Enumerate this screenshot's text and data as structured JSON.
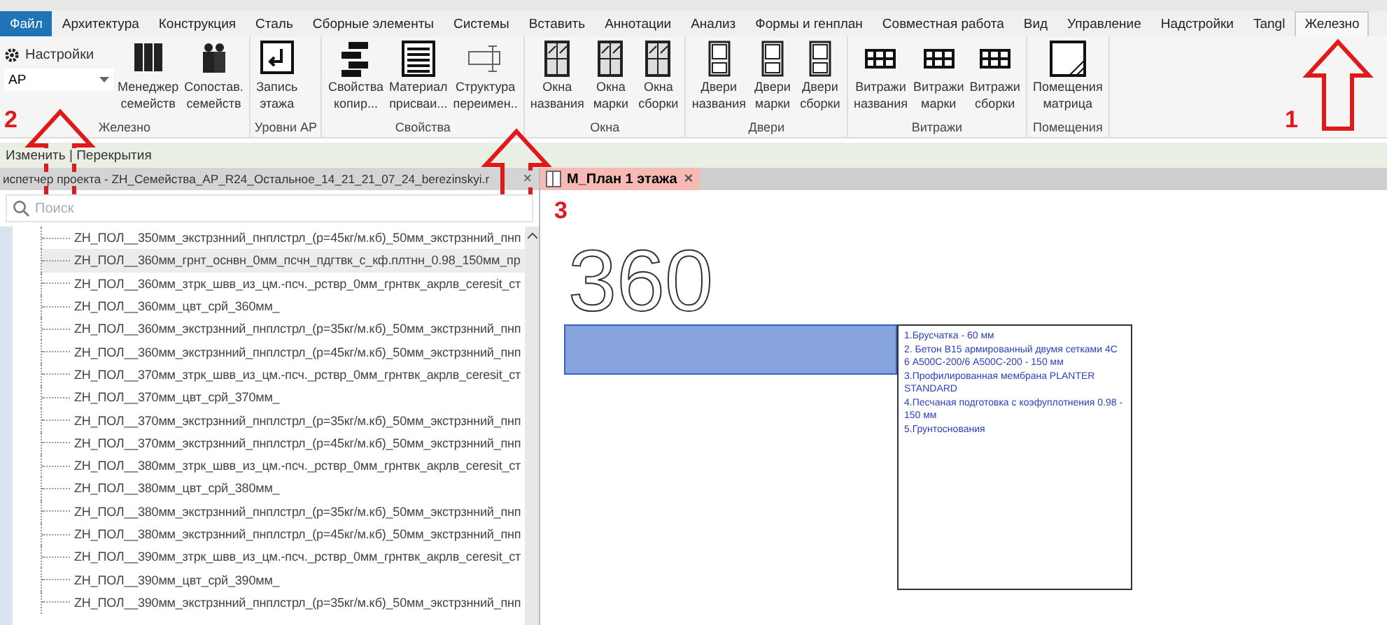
{
  "ribbon_tabs": [
    {
      "label": "Файл",
      "kind": "file",
      "selected": false
    },
    {
      "label": "Архитектура",
      "kind": "tab",
      "selected": false
    },
    {
      "label": "Конструкция",
      "kind": "tab",
      "selected": false
    },
    {
      "label": "Сталь",
      "kind": "tab",
      "selected": false
    },
    {
      "label": "Сборные элементы",
      "kind": "tab",
      "selected": false
    },
    {
      "label": "Системы",
      "kind": "tab",
      "selected": false
    },
    {
      "label": "Вставить",
      "kind": "tab",
      "selected": false
    },
    {
      "label": "Аннотации",
      "kind": "tab",
      "selected": false
    },
    {
      "label": "Анализ",
      "kind": "tab",
      "selected": false
    },
    {
      "label": "Формы и генплан",
      "kind": "tab",
      "selected": false
    },
    {
      "label": "Совместная работа",
      "kind": "tab",
      "selected": false
    },
    {
      "label": "Вид",
      "kind": "tab",
      "selected": false
    },
    {
      "label": "Управление",
      "kind": "tab",
      "selected": false
    },
    {
      "label": "Надстройки",
      "kind": "tab",
      "selected": false
    },
    {
      "label": "Tangl",
      "kind": "tab",
      "selected": false
    },
    {
      "label": "Железно",
      "kind": "tab",
      "selected": true
    }
  ],
  "ribbon_groups": [
    {
      "title": "Железно",
      "settings": {
        "label": "Настройки",
        "dropdown_value": "АР"
      },
      "buttons": [
        {
          "kind": "binders",
          "label": [
            "Менеджер",
            "семейств"
          ]
        },
        {
          "kind": "bottles",
          "label": [
            "Сопостав.",
            "семейств"
          ]
        }
      ]
    },
    {
      "title": "Уровни АР",
      "buttons": [
        {
          "kind": "level",
          "label": [
            "Запись",
            "этажа"
          ]
        }
      ]
    },
    {
      "title": "Свойства",
      "buttons": [
        {
          "kind": "copy",
          "label": [
            "Свойства",
            "копир..."
          ]
        },
        {
          "kind": "lines",
          "label": [
            "Материал",
            "присваи..."
          ]
        },
        {
          "kind": "rename",
          "label": [
            "Структура",
            "переимен.."
          ]
        }
      ]
    },
    {
      "title": "Окна",
      "buttons": [
        {
          "kind": "window",
          "label": [
            "Окна",
            "названия"
          ]
        },
        {
          "kind": "window",
          "label": [
            "Окна",
            "марки"
          ]
        },
        {
          "kind": "window",
          "label": [
            "Окна",
            "сборки"
          ]
        }
      ]
    },
    {
      "title": "Двери",
      "buttons": [
        {
          "kind": "door",
          "label": [
            "Двери",
            "названия"
          ]
        },
        {
          "kind": "door",
          "label": [
            "Двери",
            "марки"
          ]
        },
        {
          "kind": "door",
          "label": [
            "Двери",
            "сборки"
          ]
        }
      ]
    },
    {
      "title": "Витражи",
      "buttons": [
        {
          "kind": "grid",
          "label": [
            "Витражи",
            "названия"
          ]
        },
        {
          "kind": "grid",
          "label": [
            "Витражи",
            "марки"
          ]
        },
        {
          "kind": "grid",
          "label": [
            "Витражи",
            "сборки"
          ]
        }
      ]
    },
    {
      "title": "Помещения",
      "buttons": [
        {
          "kind": "room",
          "label": [
            "Помещения",
            "матрица"
          ]
        }
      ]
    }
  ],
  "context_bar": "Изменить | Перекрытия",
  "project_browser": {
    "title": "испетчер проекта - ZH_Семейства_AP_R24_Остальное_14_21_21_07_24_berezinskyi.r",
    "close": "×",
    "search": {
      "placeholder": "Поиск"
    },
    "items": [
      {
        "label": "ZH_ПОЛ__350мм_экстрзнний_пнплстрл_(р=45кг/м.кб)_50мм_экстрзнний_пнп",
        "selected": false
      },
      {
        "label": "ZH_ПОЛ__360мм_грнт_оснвн_0мм_псчн_пдгтвк_с_кф.плтнн_0.98_150мм_пр",
        "selected": true
      },
      {
        "label": "ZH_ПОЛ__360мм_зтрк_швв_из_цм.-псч._рствр_0мм_грнтвк_акрлв_ceresit_ст",
        "selected": false
      },
      {
        "label": "ZH_ПОЛ__360мм_цвт_срй_360мм_",
        "selected": false
      },
      {
        "label": "ZH_ПОЛ__360мм_экстрзнний_пнплстрл_(р=35кг/м.кб)_50мм_экстрзнний_пнп",
        "selected": false
      },
      {
        "label": "ZH_ПОЛ__360мм_экстрзнний_пнплстрл_(р=45кг/м.кб)_50мм_экстрзнний_пнп",
        "selected": false
      },
      {
        "label": "ZH_ПОЛ__370мм_зтрк_швв_из_цм.-псч._рствр_0мм_грнтвк_акрлв_ceresit_ст",
        "selected": false
      },
      {
        "label": "ZH_ПОЛ__370мм_цвт_срй_370мм_",
        "selected": false
      },
      {
        "label": "ZH_ПОЛ__370мм_экстрзнний_пнплстрл_(р=35кг/м.кб)_50мм_экстрзнний_пнп",
        "selected": false
      },
      {
        "label": "ZH_ПОЛ__370мм_экстрзнний_пнплстрл_(р=45кг/м.кб)_50мм_экстрзнний_пнп",
        "selected": false
      },
      {
        "label": "ZH_ПОЛ__380мм_зтрк_швв_из_цм.-псч._рствр_0мм_грнтвк_акрлв_ceresit_ст",
        "selected": false
      },
      {
        "label": "ZH_ПОЛ__380мм_цвт_срй_380мм_",
        "selected": false
      },
      {
        "label": "ZH_ПОЛ__380мм_экстрзнний_пнплстрл_(р=35кг/м.кб)_50мм_экстрзнний_пнп",
        "selected": false
      },
      {
        "label": "ZH_ПОЛ__380мм_экстрзнний_пнплстрл_(р=45кг/м.кб)_50мм_экстрзнний_пнп",
        "selected": false
      },
      {
        "label": "ZH_ПОЛ__390мм_зтрк_швв_из_цм.-псч._рствр_0мм_грнтвк_акрлв_ceresit_ст",
        "selected": false
      },
      {
        "label": "ZH_ПОЛ__390мм_цвт_срй_390мм_",
        "selected": false
      },
      {
        "label": "ZH_ПОЛ__390мм_экстрзнний_пнплстрл_(р=35кг/м.кб)_50мм_экстрзнний_пнп",
        "selected": false
      }
    ]
  },
  "view": {
    "tab": {
      "label": "М_План 1 этажа",
      "close": "×"
    },
    "tag": "360",
    "note": [
      "1.Брусчатка - 60 мм",
      "2. Бетон В15 армированный двумя сетками 4С 6 А500С-200/6 А500С-200 - 150 мм",
      "3.Профилированная мембрана PLANTER STANDARD",
      "4.Песчаная подготовка с коэфуплотнения 0.98 - 150 мм",
      "5.Грунтоснования"
    ]
  },
  "callouts": [
    {
      "number": "1"
    },
    {
      "number": "2"
    },
    {
      "number": "3"
    }
  ]
}
